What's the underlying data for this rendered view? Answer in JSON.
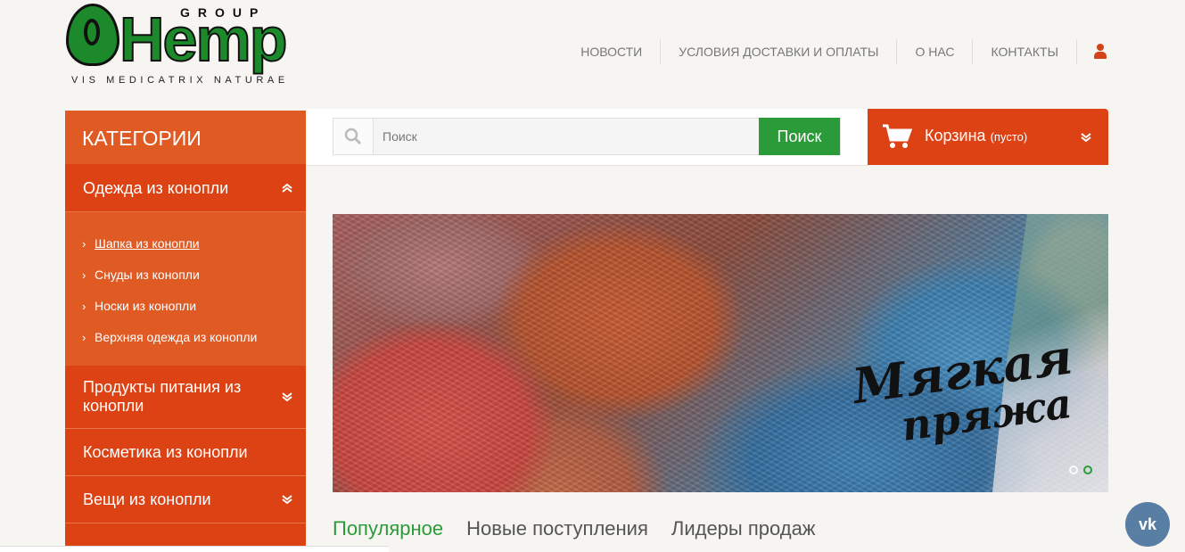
{
  "logo": {
    "group": "GROUP",
    "brand": "Hemp",
    "tagline": "VIS MEDICATRIX NATURAE"
  },
  "topnav": {
    "items": [
      "НОВОСТИ",
      "УСЛОВИЯ ДОСТАВКИ И ОПЛАТЫ",
      "О НАС",
      "КОНТАКТЫ"
    ],
    "user_icon": "user-icon"
  },
  "sidebar": {
    "title": "КАТЕГОРИИ",
    "open_category": "Одежда из конопли",
    "subcategories": [
      "Шапка из конопли",
      "Снуды из конопли",
      "Носки из конопли",
      "Верхняя одежда из конопли"
    ],
    "categories": [
      "Продукты питания из конопли",
      "Косметика из конопли",
      "Вещи из конопли"
    ]
  },
  "search": {
    "placeholder": "Поиск",
    "button": "Поиск"
  },
  "cart": {
    "label": "Корзина",
    "status": "(пусто)"
  },
  "banner": {
    "line1": "Мягкая",
    "line2": "пряжа"
  },
  "tabs": [
    "Популярное",
    "Новые поступления",
    "Лидеры продаж"
  ],
  "vk": "vk",
  "colors": {
    "accent": "#dc4213",
    "green": "#2b9a38",
    "vk": "#587ea3"
  }
}
